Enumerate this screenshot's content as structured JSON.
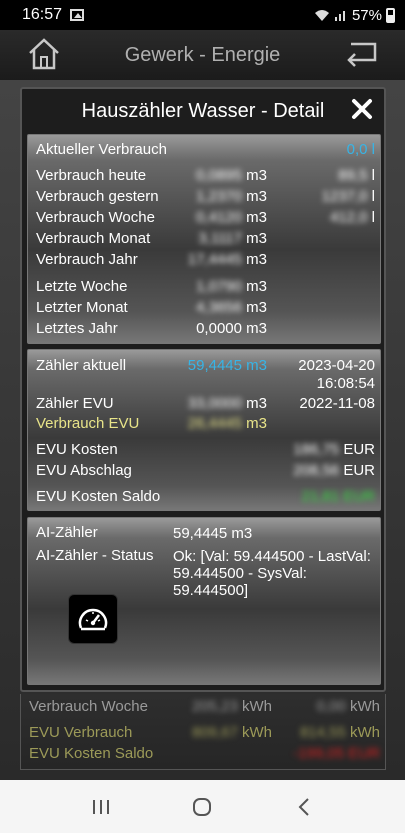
{
  "status_bar": {
    "time": "16:57",
    "battery": "57%"
  },
  "header": {
    "title": "Gewerk - Energie"
  },
  "modal": {
    "title": "Hauszähler Wasser - Detail",
    "section1": [
      {
        "label": "Aktueller Verbrauch",
        "value": "",
        "unit": "",
        "value2": "0,0 l"
      },
      {
        "label": "Verbrauch heute",
        "value": "0,0895",
        "unit": "m3",
        "value2": "89,5",
        "unit2": "l"
      },
      {
        "label": "Verbrauch gestern",
        "value": "1,2370",
        "unit": "m3",
        "value2": "1237,0",
        "unit2": "l"
      },
      {
        "label": "Verbrauch Woche",
        "value": "0,4120",
        "unit": "m3",
        "value2": "412,0",
        "unit2": "l"
      },
      {
        "label": "Verbrauch Monat",
        "value": "3,1117",
        "unit": "m3"
      },
      {
        "label": "Verbrauch Jahr",
        "value": "17,4445",
        "unit": "m3"
      },
      {
        "label": "Letzte Woche",
        "value": "1,0790",
        "unit": "m3"
      },
      {
        "label": "Letzter Monat",
        "value": "4,3656",
        "unit": "m3"
      },
      {
        "label": "Letztes Jahr",
        "value": "0,0000",
        "unit": "m3"
      }
    ],
    "section2": {
      "zaehler_aktuell": {
        "label": "Zähler aktuell",
        "value": "59,4445 m3",
        "date": "2023-04-20",
        "time": "16:08:54"
      },
      "zaehler_evu": {
        "label": "Zähler EVU",
        "value": "33,0000",
        "unit": "m3",
        "date": "2022-11-08"
      },
      "verbrauch_evu": {
        "label": "Verbrauch EVU",
        "value": "26,4445",
        "unit": "m3"
      },
      "evu_kosten": {
        "label": "EVU Kosten",
        "value": "186,75",
        "unit": "EUR"
      },
      "evu_abschlag": {
        "label": "EVU Abschlag",
        "value": "208,56",
        "unit": "EUR"
      },
      "evu_kosten_saldo": {
        "label": "EVU Kosten Saldo",
        "value": "21,81 EUR"
      }
    },
    "section3": {
      "ai_zaehler": {
        "label": "AI-Zähler",
        "value": "59,4445 m3"
      },
      "ai_status": {
        "label": "AI-Zähler - Status",
        "value": "Ok: [Val: 59.444500 - LastVal: 59.444500 - SysVal: 59.444500]"
      },
      "gauge_icon": "speedometer-icon"
    }
  },
  "below": {
    "verbrauch_woche": {
      "label": "Verbrauch Woche",
      "value": "205,23",
      "unit": "kWh",
      "value2": "0,00",
      "unit2": "kWh"
    },
    "evu_verbrauch": {
      "label": "EVU Verbrauch",
      "value": "809,67",
      "unit": "kWh",
      "value2": "814,55",
      "unit2": "kWh"
    },
    "evu_kosten_saldo": {
      "label": "EVU Kosten Saldo",
      "value2": "-199,05 EUR"
    }
  },
  "colors": {
    "cyan": "#37b4e6",
    "yellow": "#e8e489",
    "green": "#2fd83a",
    "red": "#d42020"
  }
}
